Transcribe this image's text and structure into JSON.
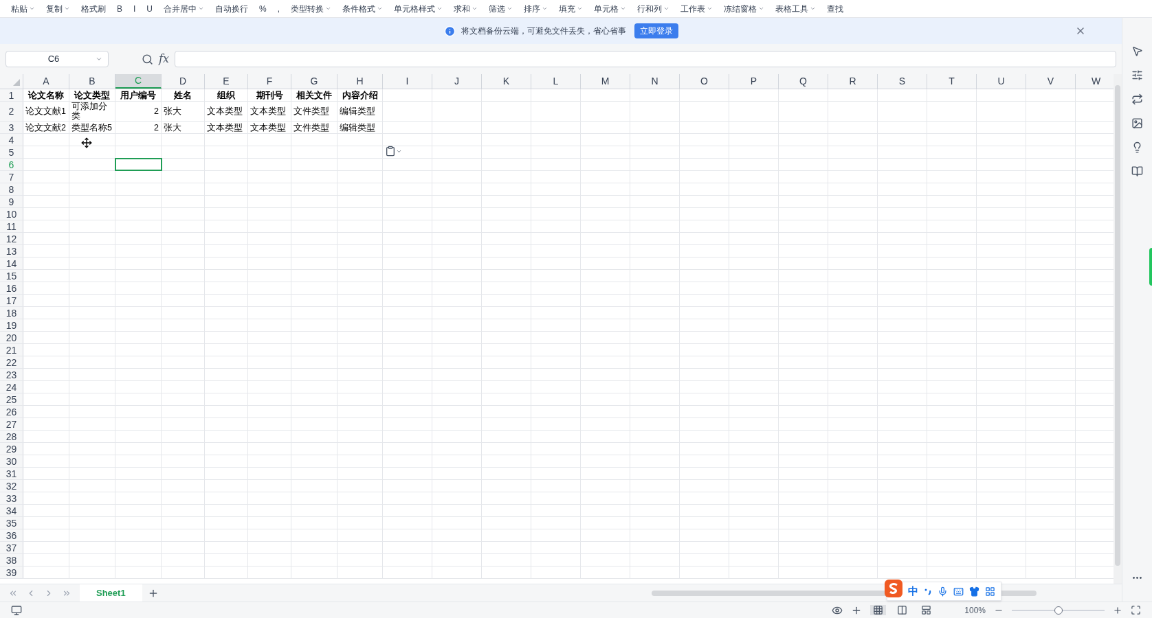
{
  "toolbar": {
    "items": [
      {
        "label": "粘贴",
        "caret": true
      },
      {
        "label": "复制",
        "caret": true
      },
      {
        "label": "格式刷",
        "caret": false
      },
      {
        "label": "B",
        "caret": false
      },
      {
        "label": "I",
        "caret": false
      },
      {
        "label": "U",
        "caret": false
      },
      {
        "label": "合并居中",
        "caret": true
      },
      {
        "label": "自动换行",
        "caret": false
      },
      {
        "label": "%",
        "caret": false
      },
      {
        "label": ",",
        "caret": false
      },
      {
        "label": "类型转换",
        "caret": true
      },
      {
        "label": "条件格式",
        "caret": true
      },
      {
        "label": "单元格样式",
        "caret": true
      },
      {
        "label": "求和",
        "caret": true
      },
      {
        "label": "筛选",
        "caret": true
      },
      {
        "label": "排序",
        "caret": true
      },
      {
        "label": "填充",
        "caret": true
      },
      {
        "label": "单元格",
        "caret": true
      },
      {
        "label": "行和列",
        "caret": true
      },
      {
        "label": "工作表",
        "caret": true
      },
      {
        "label": "冻结窗格",
        "caret": true
      },
      {
        "label": "表格工具",
        "caret": true
      },
      {
        "label": "查找",
        "caret": false
      }
    ]
  },
  "banner": {
    "message": "将文档备份云端，可避免文件丢失，省心省事",
    "button": "立即登录"
  },
  "formula_bar": {
    "name_box": "C6",
    "fx": "fx"
  },
  "columns": [
    {
      "label": "A",
      "selected": false
    },
    {
      "label": "B",
      "selected": false
    },
    {
      "label": "C",
      "selected": true
    },
    {
      "label": "D",
      "selected": false
    },
    {
      "label": "E",
      "selected": false
    },
    {
      "label": "F",
      "selected": false
    },
    {
      "label": "G",
      "selected": false
    },
    {
      "label": "H",
      "selected": false
    },
    {
      "label": "I",
      "selected": false
    },
    {
      "label": "J",
      "selected": false
    },
    {
      "label": "K",
      "selected": false
    },
    {
      "label": "L",
      "selected": false
    },
    {
      "label": "M",
      "selected": false
    },
    {
      "label": "N",
      "selected": false
    },
    {
      "label": "O",
      "selected": false
    },
    {
      "label": "P",
      "selected": false
    },
    {
      "label": "Q",
      "selected": false
    },
    {
      "label": "R",
      "selected": false
    },
    {
      "label": "S",
      "selected": false
    },
    {
      "label": "T",
      "selected": false
    },
    {
      "label": "U",
      "selected": false
    },
    {
      "label": "V",
      "selected": false
    },
    {
      "label": "W",
      "selected": false
    }
  ],
  "rows": [
    {
      "number": "1",
      "selected": false,
      "cells": [
        {
          "text": "论文名称",
          "kind": "header"
        },
        {
          "text": "论文类型",
          "kind": "header"
        },
        {
          "text": "用户编号",
          "kind": "header"
        },
        {
          "text": "姓名",
          "kind": "header"
        },
        {
          "text": "组织",
          "kind": "header"
        },
        {
          "text": "期刊号",
          "kind": "header"
        },
        {
          "text": "相关文件",
          "kind": "header"
        },
        {
          "text": "内容介绍",
          "kind": "header"
        }
      ]
    },
    {
      "number": "2",
      "selected": false,
      "cells": [
        {
          "text": "论文文献1",
          "kind": "text"
        },
        {
          "text": "可添加分类",
          "kind": "text"
        },
        {
          "text": "2",
          "kind": "number"
        },
        {
          "text": "张大",
          "kind": "text"
        },
        {
          "text": "文本类型",
          "kind": "text"
        },
        {
          "text": "文本类型",
          "kind": "text"
        },
        {
          "text": "文件类型",
          "kind": "text"
        },
        {
          "text": "编辑类型",
          "kind": "text"
        }
      ]
    },
    {
      "number": "3",
      "selected": false,
      "cells": [
        {
          "text": "论文文献2",
          "kind": "text"
        },
        {
          "text": "类型名称5",
          "kind": "text"
        },
        {
          "text": "2",
          "kind": "number"
        },
        {
          "text": "张大",
          "kind": "text"
        },
        {
          "text": "文本类型",
          "kind": "text"
        },
        {
          "text": "文本类型",
          "kind": "text"
        },
        {
          "text": "文件类型",
          "kind": "text"
        },
        {
          "text": "编辑类型",
          "kind": "text"
        }
      ]
    },
    {
      "number": "4",
      "selected": false
    },
    {
      "number": "5",
      "selected": false
    },
    {
      "number": "6",
      "selected": true
    },
    {
      "number": "7",
      "selected": false
    },
    {
      "number": "8",
      "selected": false
    },
    {
      "number": "9",
      "selected": false
    },
    {
      "number": "10",
      "selected": false
    },
    {
      "number": "11",
      "selected": false
    },
    {
      "number": "12",
      "selected": false
    },
    {
      "number": "13",
      "selected": false
    },
    {
      "number": "14",
      "selected": false
    },
    {
      "number": "15",
      "selected": false
    },
    {
      "number": "16",
      "selected": false
    },
    {
      "number": "17",
      "selected": false
    },
    {
      "number": "18",
      "selected": false
    },
    {
      "number": "19",
      "selected": false
    },
    {
      "number": "20",
      "selected": false
    },
    {
      "number": "21",
      "selected": false
    },
    {
      "number": "22",
      "selected": false
    },
    {
      "number": "23",
      "selected": false
    },
    {
      "number": "24",
      "selected": false
    },
    {
      "number": "25",
      "selected": false
    },
    {
      "number": "26",
      "selected": false
    },
    {
      "number": "27",
      "selected": false
    },
    {
      "number": "28",
      "selected": false
    },
    {
      "number": "29",
      "selected": false
    },
    {
      "number": "30",
      "selected": false
    },
    {
      "number": "31",
      "selected": false
    },
    {
      "number": "32",
      "selected": false
    },
    {
      "number": "33",
      "selected": false
    },
    {
      "number": "34",
      "selected": false
    },
    {
      "number": "35",
      "selected": false
    },
    {
      "number": "36",
      "selected": false
    },
    {
      "number": "37",
      "selected": false
    },
    {
      "number": "38",
      "selected": false
    },
    {
      "number": "39",
      "selected": false
    }
  ],
  "sheets": [
    {
      "label": "Sheet1",
      "selected": true
    }
  ],
  "status_bar": {
    "zoom": "100%",
    "zoom_slider": {
      "level": 0.5
    },
    "views": [
      {
        "selected": true
      },
      {
        "selected": false
      },
      {
        "selected": false
      }
    ]
  },
  "ime": {
    "mode": "中"
  }
}
